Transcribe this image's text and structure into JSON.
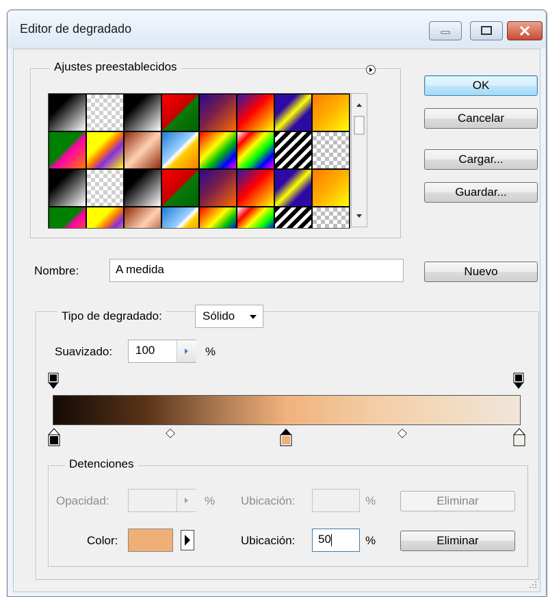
{
  "window": {
    "title": "Editor de degradado"
  },
  "presets": {
    "legend": "Ajustes preestablecidos",
    "swatches": [
      "linear-gradient(135deg,#000 0%,#000 30%,#fff 100%)",
      "repeating-conic-gradient(#cfcfcf 0% 25%,#ffffff 0% 50%) 0 0/12px 12px",
      "linear-gradient(135deg,#000 0%,#000 30%,#fff 100%)",
      "linear-gradient(135deg,#ff0000 0%,#c80000 48%,#0a7a0a 52%,#006400 100%)",
      "linear-gradient(135deg,#2a0a8c 0%,#7a1f4a 45%,#ff6a00 100%)",
      "linear-gradient(135deg,#2a1aa8 0%,#ff0000 45%,#ffff00 100%)",
      "linear-gradient(135deg,#2d0aa5 0%,#2d0aa5 30%,#ffff00 50%,#2d0aa5 70%)",
      "linear-gradient(135deg,#ff7a00 0%,#ffb000 50%,#ffff00 100%)",
      "linear-gradient(135deg,#008000 0%,#008000 45%,#ff00aa 55%,#ff7a00 100%)",
      "linear-gradient(135deg,#ffff00 0%,#ffff00 35%,#ff7a00 50%,#8a2be2 65%,#ffff00 100%)",
      "linear-gradient(135deg,#8b2a0a 0%,#ffd0b0 50%,#8b2a0a 100%)",
      "linear-gradient(135deg,#1e7bd4 0%,#9bd0ff 45%,#ffffff 50%,#ffcc00 60%,#ff7a00 100%)",
      "linear-gradient(135deg,#ff0000,#ff7a00,#ffff00,#00c000,#0000ff,#ff00ff)",
      "linear-gradient(135deg,#ffffff 0%,#ff0000 20%,#ffff00 40%,#00ff00 60%,#0000ff 80%,#ff00ff 100%)",
      "repeating-linear-gradient(135deg,#000 0 6px,#fff 6px 11px)",
      "repeating-conic-gradient(#bdbdbd 0% 25%,#ffffff 0% 50%) 0 0/12px 12px",
      "linear-gradient(135deg,#000 0%,#000 30%,#fff 100%)",
      "repeating-conic-gradient(#cfcfcf 0% 25%,#ffffff 0% 50%) 0 0/12px 12px",
      "linear-gradient(135deg,#000 0%,#000 30%,#fff 100%)",
      "linear-gradient(135deg,#ff0000 0%,#c80000 48%,#0a7a0a 52%,#006400 100%)",
      "linear-gradient(135deg,#2a0a8c 0%,#7a1f4a 45%,#ff6a00 100%)",
      "linear-gradient(135deg,#2a1aa8 0%,#ff0000 45%,#ffff00 100%)",
      "linear-gradient(135deg,#2d0aa5 0%,#2d0aa5 30%,#ffff00 50%,#2d0aa5 70%)",
      "linear-gradient(135deg,#ff7a00 0%,#ffb000 50%,#ffff00 100%)",
      "linear-gradient(135deg,#008000 0%,#008000 45%,#ff00aa 55%,#ff7a00 100%)",
      "linear-gradient(135deg,#ffff00 0%,#ffff00 35%,#ff7a00 50%,#8a2be2 65%,#ffff00 100%)",
      "linear-gradient(135deg,#8b2a0a 0%,#ffd0b0 50%,#8b2a0a 100%)",
      "linear-gradient(135deg,#1e7bd4 0%,#9bd0ff 45%,#ffffff 50%,#ffcc00 60%,#ff7a00 100%)",
      "linear-gradient(135deg,#ff0000,#ff7a00,#ffff00,#00c000,#0000ff,#ff00ff)",
      "linear-gradient(135deg,#ffffff 0%,#ff0000 20%,#ffff00 40%,#00ff00 60%,#0000ff 80%,#ff00ff 100%)",
      "repeating-linear-gradient(135deg,#000 0 6px,#fff 6px 11px)",
      "repeating-conic-gradient(#bdbdbd 0% 25%,#ffffff 0% 50%) 0 0/12px 12px"
    ]
  },
  "buttons": {
    "ok": "OK",
    "cancel": "Cancelar",
    "load": "Cargar...",
    "save": "Guardar...",
    "new": "Nuevo"
  },
  "name": {
    "label": "Nombre:",
    "value": "A medida"
  },
  "gradient": {
    "type_label": "Tipo de degradado:",
    "type_value": "Sólido",
    "smoothness_label": "Suavizado:",
    "smoothness_value": "100",
    "smoothness_unit": "%",
    "selected_stop_color": "#eeb077"
  },
  "stops": {
    "legend": "Detenciones",
    "opacity_label": "Opacidad:",
    "opacity_value": "",
    "opacity_unit": "%",
    "opacity_location_label": "Ubicación:",
    "opacity_location_value": "",
    "opacity_location_unit": "%",
    "opacity_delete": "Eliminar",
    "color_label": "Color:",
    "color_location_label": "Ubicación:",
    "color_location_value": "50",
    "color_location_unit": "%",
    "color_delete": "Eliminar"
  }
}
